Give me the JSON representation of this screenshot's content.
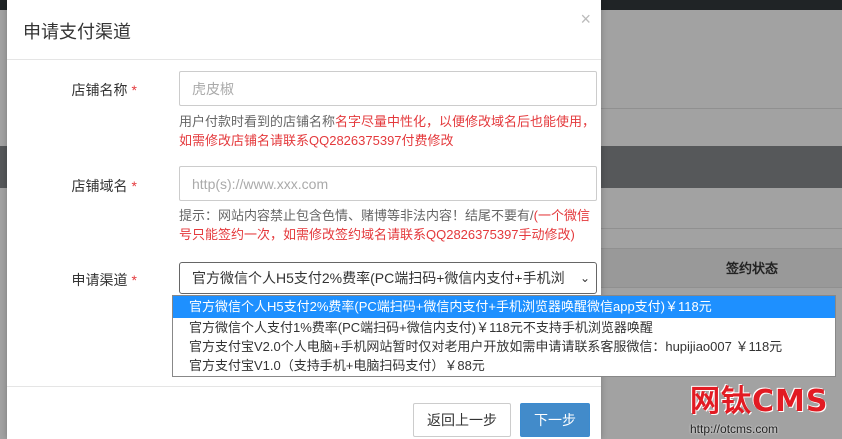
{
  "background": {
    "table_header_label": "签约状态"
  },
  "modal": {
    "title": "申请支付渠道",
    "close_glyph": "×"
  },
  "form": {
    "required_mark": "*",
    "shop_name": {
      "label": "店铺名称",
      "placeholder": "虎皮椒",
      "help_normal": "用户付款时看到的店铺名称",
      "help_red": "名字尽量中性化，以便修改域名后也能使用，如需修改店铺名请联系QQ2826375397付费修改"
    },
    "shop_domain": {
      "label": "店铺域名",
      "placeholder": "http(s)://www.xxx.com",
      "help_normal": "提示：网站内容禁止包含色情、赌博等非法内容！结尾不要有/",
      "help_red": "(一个微信号只能签约一次，如需修改签约域名请联系QQ2826375397手动修改)"
    },
    "channel": {
      "label": "申请渠道",
      "selected_value": "官方微信个人H5支付2%费率(PC端扫码+微信内支付+手机浏",
      "arrow_glyph": "⌄",
      "options": [
        "官方微信个人H5支付2%费率(PC端扫码+微信内支付+手机浏览器唤醒微信app支付)￥118元",
        "官方微信个人支付1%费率(PC端扫码+微信内支付)￥118元不支持手机浏览器唤醒",
        "官方支付宝V2.0个人电脑+手机网站暂时仅对老用户开放如需申请请联系客服微信：hupijiao007 ￥118元",
        "官方支付宝V1.0（支持手机+电脑扫码支付）￥88元"
      ]
    }
  },
  "footer": {
    "back_label": "返回上一步",
    "next_label": "下一步"
  },
  "watermark": {
    "logo": "网钛CMS",
    "url": "http://otcms.com"
  },
  "colors": {
    "accent": "#428bca",
    "highlight": "#1e90ff",
    "warning_text": "#e4393c"
  }
}
